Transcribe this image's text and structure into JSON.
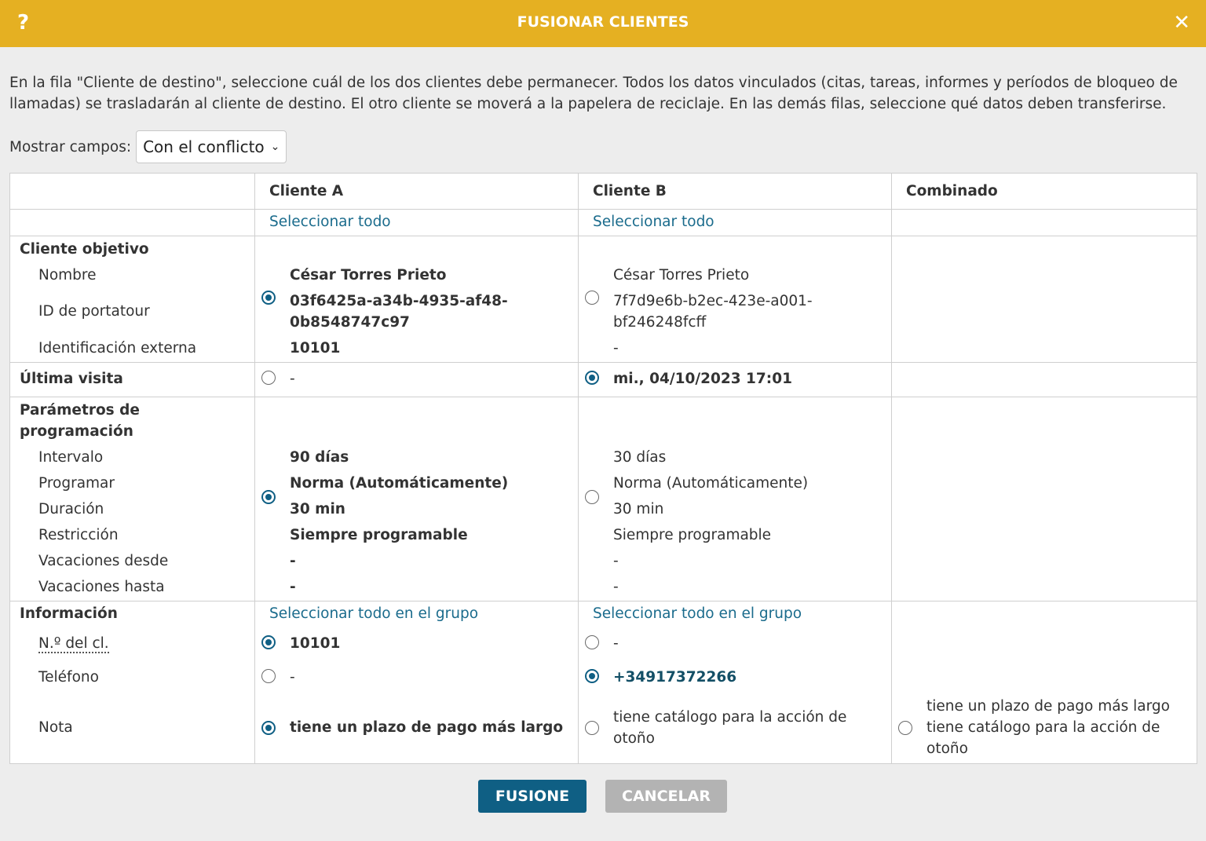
{
  "dialog": {
    "help_icon": "?",
    "title": "FUSIONAR CLIENTES",
    "close_icon": "✕",
    "intro": "En la fila \"Cliente de destino\", seleccione cuál de los dos clientes debe permanecer. Todos los datos vinculados (citas, tareas, informes y períodos de bloqueo de llamadas) se trasladarán al cliente de destino. El otro cliente se moverá a la papelera de reciclaje. En las demás filas, seleccione qué datos deben transferirse.",
    "filter_label": "Mostrar campos:",
    "filter_value": "Con el conflicto",
    "filter_chevron": "⌄"
  },
  "table": {
    "headers": [
      "",
      "Cliente A",
      "Cliente B",
      "Combinado"
    ],
    "select_all": "Seleccionar todo",
    "select_all_group": "Seleccionar todo en el grupo",
    "target": {
      "title": "Cliente objetivo",
      "labels": [
        "Nombre",
        "ID de portatour",
        "Identificación externa"
      ],
      "a": {
        "name": "César Torres Prieto",
        "id_line1": "03f6425a-a34b-4935-af48-",
        "id_line2": "0b8548747c97",
        "external": "10101",
        "selected": true
      },
      "b": {
        "name": "César Torres Prieto",
        "id_line1": "7f7d9e6b-b2ec-423e-a001-",
        "id_line2": "bf246248fcff",
        "external": "-",
        "selected": false
      }
    },
    "last_visit": {
      "title": "Última visita",
      "a": {
        "value": "-",
        "selected": false
      },
      "b": {
        "value": "mi., 04/10/2023 17:01",
        "selected": true
      }
    },
    "scheduling": {
      "title_line1": "Parámetros de",
      "title_line2": "programación",
      "labels": [
        "Intervalo",
        "Programar",
        "Duración",
        "Restricción",
        "Vacaciones desde",
        "Vacaciones hasta"
      ],
      "a": {
        "values": [
          "90 días",
          "Norma (Automáticamente)",
          "30 min",
          "Siempre programable",
          "-",
          "-"
        ],
        "selected": true
      },
      "b": {
        "values": [
          "30 días",
          "Norma (Automáticamente)",
          "30 min",
          "Siempre programable",
          "-",
          "-"
        ],
        "selected": false
      }
    },
    "info": {
      "title": "Información",
      "customer_no": {
        "label": "N.º del cl.",
        "a": "10101",
        "b": "-"
      },
      "phone": {
        "label": "Teléfono",
        "a": "-",
        "b": "+34917372266"
      },
      "note": {
        "label": "Nota",
        "a": "tiene un plazo de pago más largo",
        "b_line1": "tiene catálogo para la acción de",
        "b_line2": "otoño",
        "combined_line1": "tiene un plazo de pago más largo",
        "combined_line2": "tiene catálogo para la acción de",
        "combined_line3": "otoño"
      }
    }
  },
  "buttons": {
    "merge": "FUSIONE",
    "cancel": "CANCELAR"
  },
  "colors": {
    "header_bar": "#e5b022",
    "primary": "#0f5f84",
    "link": "#1a6b8c",
    "disabled_button": "#b3b3b3"
  }
}
